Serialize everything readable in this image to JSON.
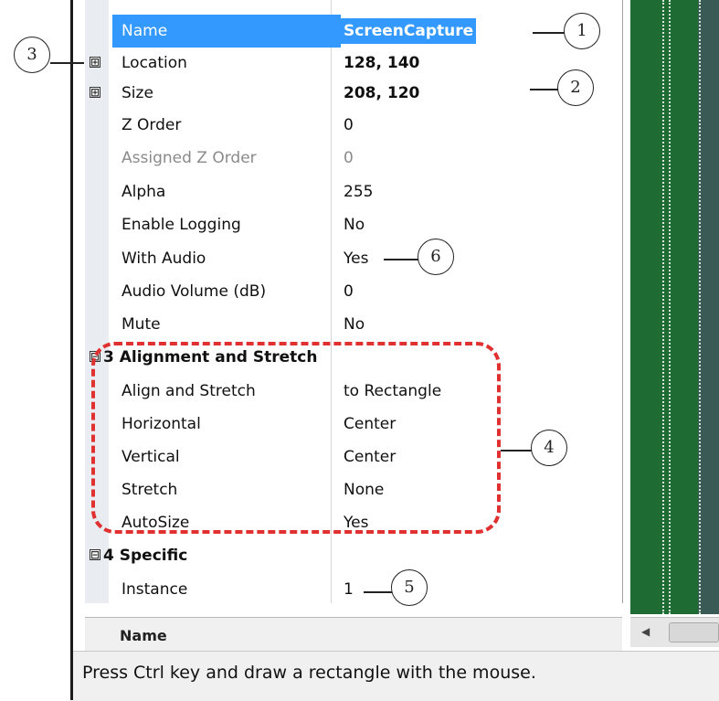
{
  "rows": [
    {
      "label": "Name",
      "value": "ScreenCapture"
    },
    {
      "label": "Location",
      "value": "128, 140"
    },
    {
      "label": "Size",
      "value": "208, 120"
    },
    {
      "label": "Z Order",
      "value": "0"
    },
    {
      "label": "Assigned Z Order",
      "value": "0"
    },
    {
      "label": "Alpha",
      "value": "255"
    },
    {
      "label": "Enable Logging",
      "value": "No"
    },
    {
      "label": "With Audio",
      "value": "Yes"
    },
    {
      "label": "Audio Volume (dB)",
      "value": "0"
    },
    {
      "label": "Mute",
      "value": "No"
    },
    {
      "label": "3 Alignment and Stretch",
      "value": ""
    },
    {
      "label": "Align and Stretch",
      "value": "to Rectangle"
    },
    {
      "label": "Horizontal",
      "value": "Center"
    },
    {
      "label": "Vertical",
      "value": "Center"
    },
    {
      "label": "Stretch",
      "value": "None"
    },
    {
      "label": "AutoSize",
      "value": "Yes"
    },
    {
      "label": "4 Specific",
      "value": ""
    },
    {
      "label": "Instance",
      "value": "1"
    }
  ],
  "expanders": {
    "collapsed": "⊞",
    "expanded": "⊟"
  },
  "description": {
    "title": "Name"
  },
  "status_bar": {
    "text": "Press Ctrl key and draw a rectangle with the mouse."
  },
  "callouts": [
    "1",
    "2",
    "3",
    "4",
    "5",
    "6"
  ],
  "colors": {
    "selection": "#3399ff",
    "highlight_box": "#e03030",
    "canvas": "#1f6b34"
  }
}
